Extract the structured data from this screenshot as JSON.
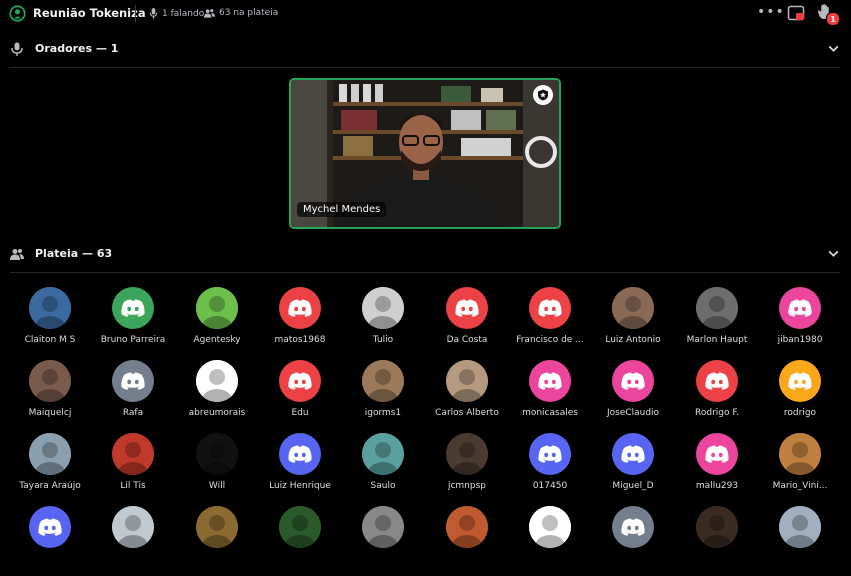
{
  "topbar": {
    "title": "Reunião Tokeniza",
    "speaking": "1 falando",
    "audience": "63 na plateia",
    "hand_count": "1"
  },
  "speakers": {
    "header": "Oradores — 1",
    "tile": {
      "name": "Mychel Mendes"
    }
  },
  "audience": {
    "header": "Plateia — 63",
    "members": [
      {
        "name": "Claiton M S",
        "kind": "photo",
        "bg": "#3b6aa0"
      },
      {
        "name": "Bruno Parreira",
        "kind": "discord",
        "bg": "#3ba55c"
      },
      {
        "name": "Agentesky",
        "kind": "photo",
        "bg": "#6cbf4b"
      },
      {
        "name": "matos1968",
        "kind": "discord",
        "bg": "#ed4245"
      },
      {
        "name": "Tulio",
        "kind": "photo",
        "bg": "#cfcfcf"
      },
      {
        "name": "Da Costa",
        "kind": "discord",
        "bg": "#ed4245"
      },
      {
        "name": "Francisco de ...",
        "kind": "discord",
        "bg": "#ed4245"
      },
      {
        "name": "Luiz Antonio",
        "kind": "photo",
        "bg": "#8a6a55"
      },
      {
        "name": "Marlon Haupt",
        "kind": "photo",
        "bg": "#6d6d6d"
      },
      {
        "name": "jiban1980",
        "kind": "discord",
        "bg": "#eb459e"
      },
      {
        "name": "Maiquelcj",
        "kind": "photo",
        "bg": "#7a5a4a"
      },
      {
        "name": "Rafa",
        "kind": "discord",
        "bg": "#747f8d"
      },
      {
        "name": "abreumorais",
        "kind": "photo",
        "bg": "#ffffff"
      },
      {
        "name": "Edu",
        "kind": "discord",
        "bg": "#ed4245"
      },
      {
        "name": "igorms1",
        "kind": "photo",
        "bg": "#9a7a5a"
      },
      {
        "name": "Carlos Alberto",
        "kind": "photo",
        "bg": "#b59a80"
      },
      {
        "name": "monicasales",
        "kind": "discord",
        "bg": "#eb459e"
      },
      {
        "name": "JoseClaudio",
        "kind": "discord",
        "bg": "#eb459e"
      },
      {
        "name": "Rodrigo F.",
        "kind": "discord",
        "bg": "#ed4245"
      },
      {
        "name": "rodrigo",
        "kind": "discord",
        "bg": "#faa81a"
      },
      {
        "name": "Tayara Araújo",
        "kind": "photo",
        "bg": "#8aa0b0"
      },
      {
        "name": "Lil Tis",
        "kind": "photo",
        "bg": "#c0392b"
      },
      {
        "name": "Will",
        "kind": "photo",
        "bg": "#111111"
      },
      {
        "name": "Luiz Henrique",
        "kind": "discord",
        "bg": "#5865f2"
      },
      {
        "name": "Saulo",
        "kind": "photo",
        "bg": "#5aa0a0"
      },
      {
        "name": "jcmnpsp",
        "kind": "photo",
        "bg": "#4a3a30"
      },
      {
        "name": "017450",
        "kind": "discord",
        "bg": "#5865f2"
      },
      {
        "name": "Miguel_D",
        "kind": "discord",
        "bg": "#5865f2"
      },
      {
        "name": "mallu293",
        "kind": "discord",
        "bg": "#eb459e"
      },
      {
        "name": "Mario_Vini...",
        "kind": "photo",
        "bg": "#c08040"
      },
      {
        "name": "",
        "kind": "discord",
        "bg": "#5865f2"
      },
      {
        "name": "",
        "kind": "photo",
        "bg": "#c0c8d0"
      },
      {
        "name": "",
        "kind": "photo",
        "bg": "#8a6a30"
      },
      {
        "name": "",
        "kind": "photo",
        "bg": "#2a5a2a"
      },
      {
        "name": "",
        "kind": "photo",
        "bg": "#888888"
      },
      {
        "name": "",
        "kind": "photo",
        "bg": "#c05a30"
      },
      {
        "name": "",
        "kind": "photo",
        "bg": "#ffffff"
      },
      {
        "name": "",
        "kind": "discord",
        "bg": "#747f8d"
      },
      {
        "name": "",
        "kind": "photo",
        "bg": "#3a2a20"
      },
      {
        "name": "",
        "kind": "photo",
        "bg": "#a0b0c0"
      }
    ]
  }
}
